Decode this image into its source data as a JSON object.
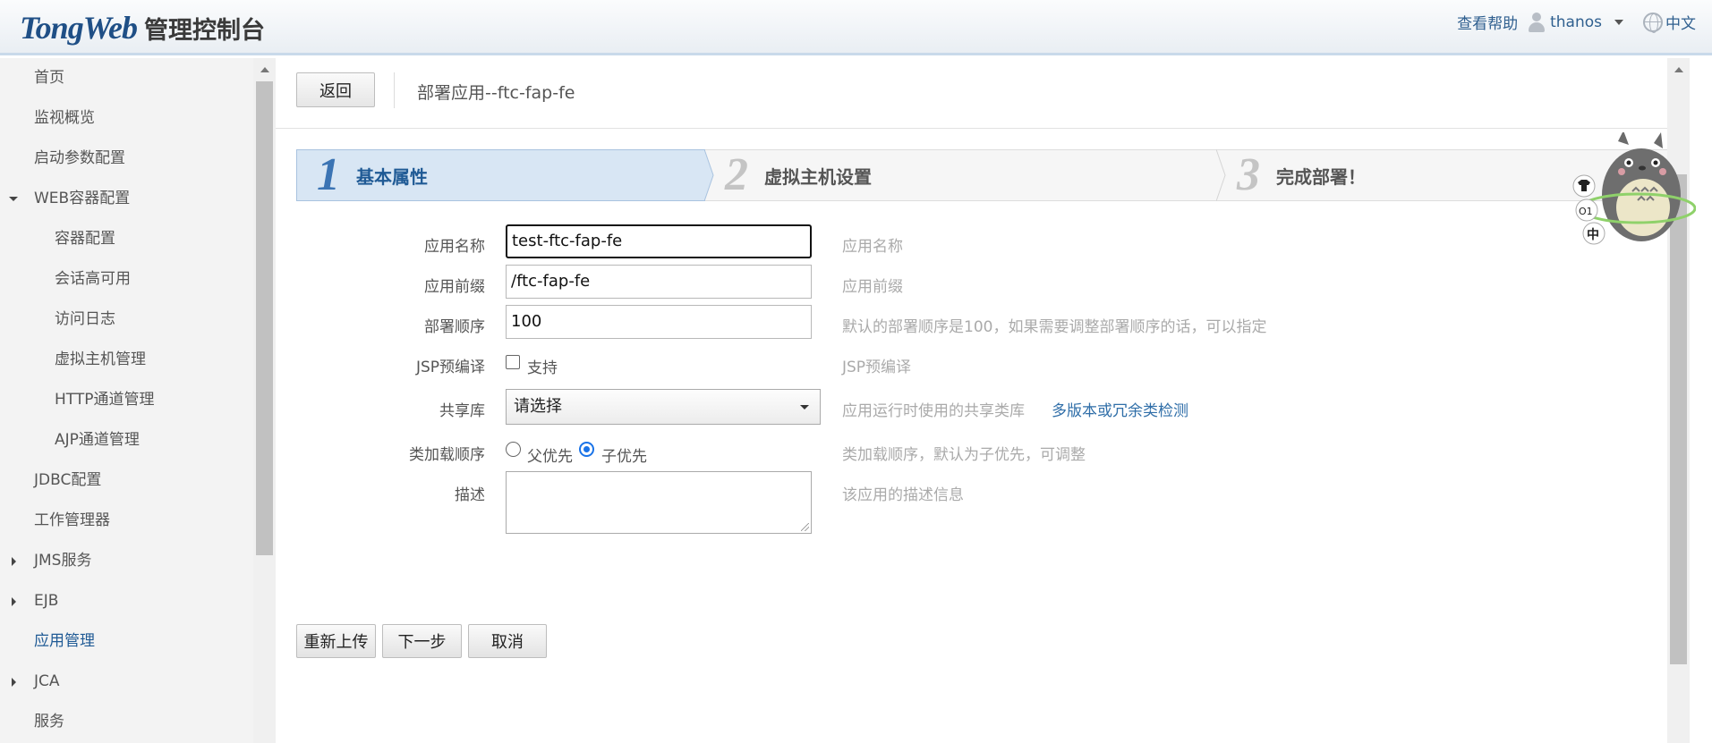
{
  "header": {
    "brand": "TongWeb",
    "console_title": "管理控制台",
    "help_label": "查看帮助",
    "username": "thanos",
    "language": "中文"
  },
  "sidebar": {
    "items": [
      {
        "label": "首页"
      },
      {
        "label": "监视概览"
      },
      {
        "label": "启动参数配置"
      },
      {
        "label": "WEB容器配置"
      },
      {
        "label": "容器配置"
      },
      {
        "label": "会话高可用"
      },
      {
        "label": "访问日志"
      },
      {
        "label": "虚拟主机管理"
      },
      {
        "label": "HTTP通道管理"
      },
      {
        "label": "AJP通道管理"
      },
      {
        "label": "JDBC配置"
      },
      {
        "label": "工作管理器"
      },
      {
        "label": "JMS服务"
      },
      {
        "label": "EJB"
      },
      {
        "label": "应用管理"
      },
      {
        "label": "JCA"
      },
      {
        "label": "服务"
      }
    ]
  },
  "toolbar": {
    "back_label": "返回",
    "page_title": "部署应用--ftc-fap-fe"
  },
  "steps": [
    {
      "num": "1",
      "label": "基本属性"
    },
    {
      "num": "2",
      "label": "虚拟主机设置"
    },
    {
      "num": "3",
      "label": "完成部署！"
    }
  ],
  "form": {
    "app_name": {
      "label": "应用名称",
      "value": "test-ftc-fap-fe",
      "hint": "应用名称"
    },
    "app_prefix": {
      "label": "应用前缀",
      "value": "/ftc-fap-fe",
      "hint": "应用前缀"
    },
    "deploy_order": {
      "label": "部署顺序",
      "value": "100",
      "hint": "默认的部署顺序是100，如果需要调整部署顺序的话，可以指定"
    },
    "jsp_precompile": {
      "label": "JSP预编译",
      "option": "支持",
      "checked": false,
      "hint": "JSP预编译"
    },
    "shared_lib": {
      "label": "共享库",
      "selected": "请选择",
      "hint": "应用运行时使用的共享类库",
      "link": "多版本或冗余类检测"
    },
    "class_loading": {
      "label": "类加载顺序",
      "option_parent": "父优先",
      "option_child": "子优先",
      "selected": "子优先",
      "hint": "类加载顺序，默认为子优先，可调整"
    },
    "description": {
      "label": "描述",
      "value": "",
      "hint": "该应用的描述信息"
    }
  },
  "actions": {
    "reupload": "重新上传",
    "next": "下一步",
    "cancel": "取消"
  },
  "mascot": {
    "badge_text": "中"
  }
}
